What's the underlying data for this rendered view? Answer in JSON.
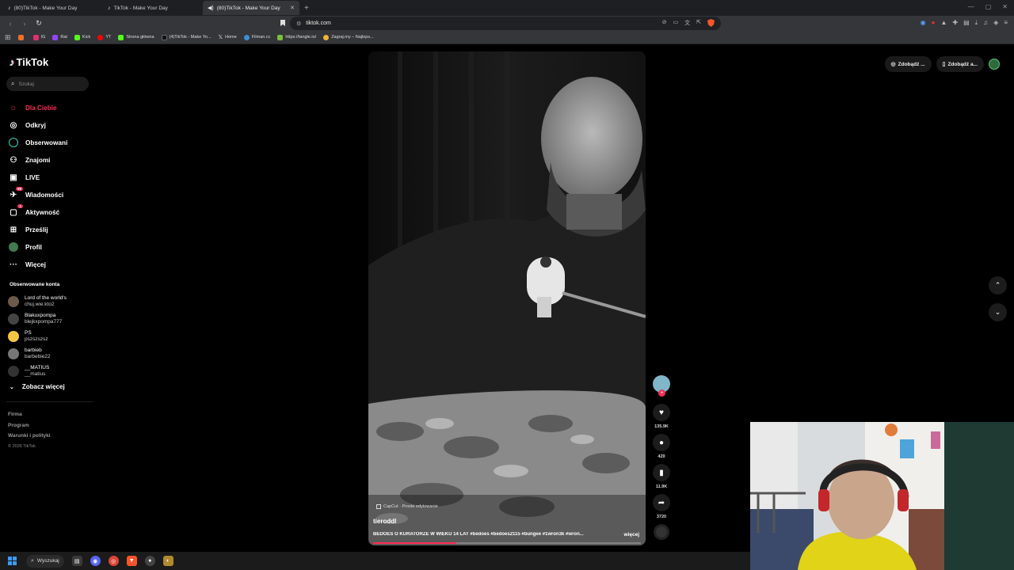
{
  "browser": {
    "tabs": [
      {
        "label": "(80)TikTok - Make Your Day",
        "active": false
      },
      {
        "label": "TikTok - Make Your Day",
        "active": false
      },
      {
        "label": "(80)TikTok - Make Your Day",
        "active": true
      }
    ],
    "url": "tiktok.com",
    "bookmarks": [
      {
        "label": "IG",
        "color": "#e1306c"
      },
      {
        "label": "Rat",
        "color": "#9146ff"
      },
      {
        "label": "Kick",
        "color": "#53fc18"
      },
      {
        "label": "YT",
        "color": "#ff0000"
      },
      {
        "label": "Strona główna",
        "color": "#53fc18"
      },
      {
        "label": "(4)TikTok - Make Yo...",
        "color": "#222222"
      },
      {
        "label": "Home",
        "color": "#222222"
      },
      {
        "label": "Filman.cc",
        "color": "#3a8fd8"
      },
      {
        "label": "https://tangle.io/",
        "color": "#7bbf3a"
      },
      {
        "label": "Zagraj.my – Najleps...",
        "color": "#f2b233"
      }
    ]
  },
  "tiktok": {
    "logo": "TikTok",
    "search_placeholder": "Szukaj",
    "menu": [
      {
        "label": "Dla Ciebie",
        "icon": "home-icon",
        "active": true
      },
      {
        "label": "Odkryj",
        "icon": "compass-icon",
        "active": false
      },
      {
        "label": "Obserwowani",
        "icon": "following-icon",
        "active": false
      },
      {
        "label": "Znajomi",
        "icon": "friends-icon",
        "active": false
      },
      {
        "label": "LIVE",
        "icon": "live-icon",
        "active": false
      },
      {
        "label": "Wiadomości",
        "icon": "messages-icon",
        "active": false,
        "badge": "99"
      },
      {
        "label": "Aktywność",
        "icon": "activity-icon",
        "active": false,
        "badge": "1"
      },
      {
        "label": "Prześlij",
        "icon": "upload-icon",
        "active": false
      },
      {
        "label": "Profil",
        "icon": "profile-icon",
        "active": false
      },
      {
        "label": "Więcej",
        "icon": "more-icon",
        "active": false
      }
    ],
    "followed_title": "Obserwowane konta",
    "followed_accounts": [
      {
        "name": "Lord of the world's",
        "user": "chuj.wie.kto2"
      },
      {
        "name": "Blakuxpompa",
        "user": "blejkxpompa777"
      },
      {
        "name": "PS",
        "user": "pszszszsz"
      },
      {
        "name": "barbieb",
        "user": "barbebie22"
      },
      {
        "name": "__MATIUS",
        "user": "__matius"
      }
    ],
    "see_more": "Zobacz więcej",
    "footer": [
      "Firma",
      "Program",
      "Warunki i polityki"
    ],
    "copyright": "© 2026 TikTok",
    "top_buttons": [
      "Zdobądź ...",
      "Zdobądź a..."
    ]
  },
  "video": {
    "capcut_label": "CapCut · Proste edytowanie",
    "author": "tieroddl",
    "description": "BEDOES O KURATORZE W WIEKU 14 LAT #bedoes #bedoes2115 #bungee #1wron3k #wron...",
    "more_label": "więcej",
    "progress": 0.31,
    "likes": "135.9K",
    "comments": "420",
    "saves": "11.9K",
    "shares": "3720"
  },
  "taskbar": {
    "search_label": "Wyszukaj"
  }
}
